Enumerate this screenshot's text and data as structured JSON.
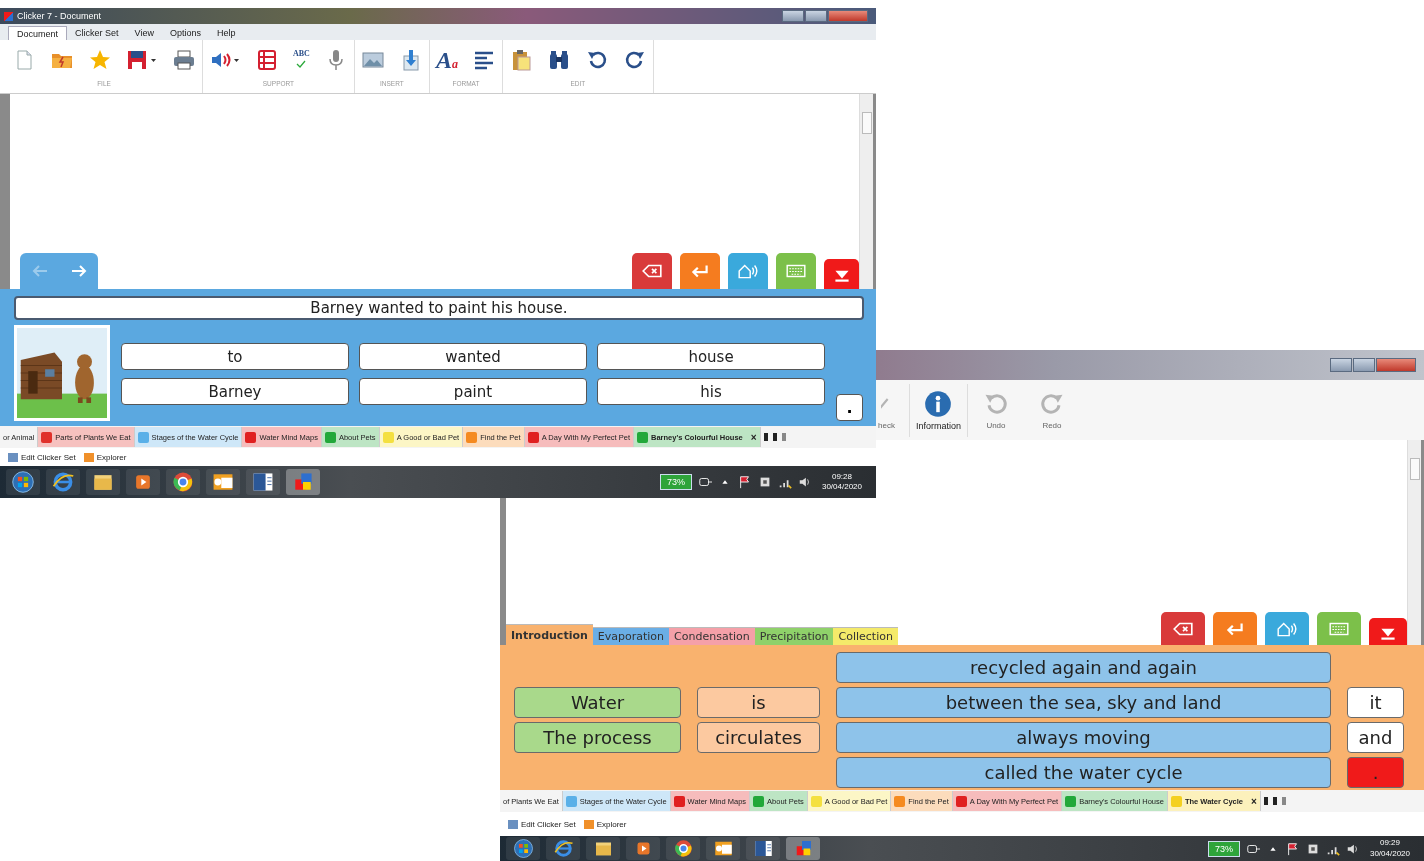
{
  "window_1": {
    "title": "Clicker 7 - Document",
    "menu": [
      {
        "label": "Document",
        "selected": true
      },
      {
        "label": "Clicker Set",
        "selected": false
      },
      {
        "label": "View",
        "selected": false
      },
      {
        "label": "Options",
        "selected": false
      },
      {
        "label": "Help",
        "selected": false
      }
    ],
    "toolbar_groups": [
      "FILE",
      "SUPPORT",
      "INSERT",
      "FORMAT",
      "EDIT"
    ],
    "spelling_button": "ABC",
    "font_button": {
      "big": "A",
      "small": "a"
    },
    "nav": [
      {
        "disabled": true
      },
      {
        "disabled": false
      }
    ],
    "sentence": "Barney wanted to paint his house.",
    "word_rows": [
      [
        "to",
        "wanted",
        "house"
      ],
      [
        "Barney",
        "paint",
        "his"
      ]
    ],
    "punctuation": ".",
    "set_tabs": [
      {
        "label": "or Animal",
        "selected": false
      },
      {
        "label": "Parts of Plants We Eat",
        "color": "#e0302a",
        "selected": false
      },
      {
        "label": "Stages of the Water Cycle",
        "color": "#5ab0e8",
        "selected": false
      },
      {
        "label": "Water Mind Maps",
        "color": "#e02020",
        "selected": false
      },
      {
        "label": "About Pets",
        "color": "#22a83a",
        "selected": false
      },
      {
        "label": "A Good or Bad Pet",
        "color": "#f4e040",
        "selected": false
      },
      {
        "label": "Find the Pet",
        "color": "#f58a20",
        "selected": false
      },
      {
        "label": "A Day With My Perfect Pet",
        "color": "#e02020",
        "selected": false
      },
      {
        "label": "Barney's Colourful House",
        "color": "#22a83a",
        "selected": true,
        "close": "×"
      }
    ],
    "links": [
      "Edit Clicker Set",
      "Explorer"
    ],
    "taskbar": {
      "battery": "73%",
      "time": "09:28",
      "date": "30/04/2020"
    }
  },
  "window_2": {
    "toolbar": [
      {
        "label": "heck",
        "disabled": true
      },
      {
        "label": "Information",
        "disabled": false
      },
      {
        "label": "Undo",
        "disabled": true
      },
      {
        "label": "Redo",
        "disabled": true
      }
    ],
    "page_tabs": [
      {
        "label": "Introduction",
        "color": "#f9b26e",
        "selected": true
      },
      {
        "label": "Evaporation",
        "color": "#6aaee6",
        "selected": false
      },
      {
        "label": "Condensation",
        "color": "#f5a0a8",
        "selected": false
      },
      {
        "label": "Precipitation",
        "color": "#8fd16a",
        "selected": false
      },
      {
        "label": "Collection",
        "color": "#f4ea6a",
        "selected": false
      }
    ],
    "columns": [
      {
        "cells": [
          {
            "text": "Water",
            "color": "#a9d98b"
          },
          {
            "text": "The process",
            "color": "#a9d98b"
          }
        ]
      },
      {
        "cells": [
          {
            "text": "is",
            "color": "#fcc9a0"
          },
          {
            "text": "circulates",
            "color": "#fcc9a0"
          }
        ]
      },
      {
        "cells": [
          {
            "text": "recycled again and again",
            "color": "#8ec3ea"
          },
          {
            "text": "between the sea, sky and land",
            "color": "#8ec3ea"
          },
          {
            "text": "always moving",
            "color": "#8ec3ea"
          },
          {
            "text": "called the water cycle",
            "color": "#8ec3ea"
          }
        ]
      },
      {
        "cells": [
          {
            "text": "it",
            "color": "#ffffff"
          },
          {
            "text": "and",
            "color": "#ffffff"
          },
          {
            "text": ".",
            "color": "#f01a1a"
          }
        ]
      }
    ],
    "set_tabs": [
      {
        "label": "of Plants We Eat",
        "selected": false
      },
      {
        "label": "Stages of the Water Cycle",
        "color": "#5ab0e8",
        "selected": false
      },
      {
        "label": "Water Mind Maps",
        "color": "#e02020",
        "selected": false
      },
      {
        "label": "About Pets",
        "color": "#22a83a",
        "selected": false
      },
      {
        "label": "A Good or Bad Pet",
        "color": "#f4e040",
        "selected": false
      },
      {
        "label": "Find the Pet",
        "color": "#f58a20",
        "selected": false
      },
      {
        "label": "A Day With My Perfect Pet",
        "color": "#e02020",
        "selected": false
      },
      {
        "label": "Barney's Colourful House",
        "color": "#22a83a",
        "selected": false
      },
      {
        "label": "The Water Cycle",
        "color": "#f4d020",
        "selected": true,
        "close": "×"
      }
    ],
    "links": [
      "Edit Clicker Set",
      "Explorer"
    ],
    "taskbar": {
      "battery": "73%",
      "time": "09:29",
      "date": "30/04/2020"
    }
  }
}
